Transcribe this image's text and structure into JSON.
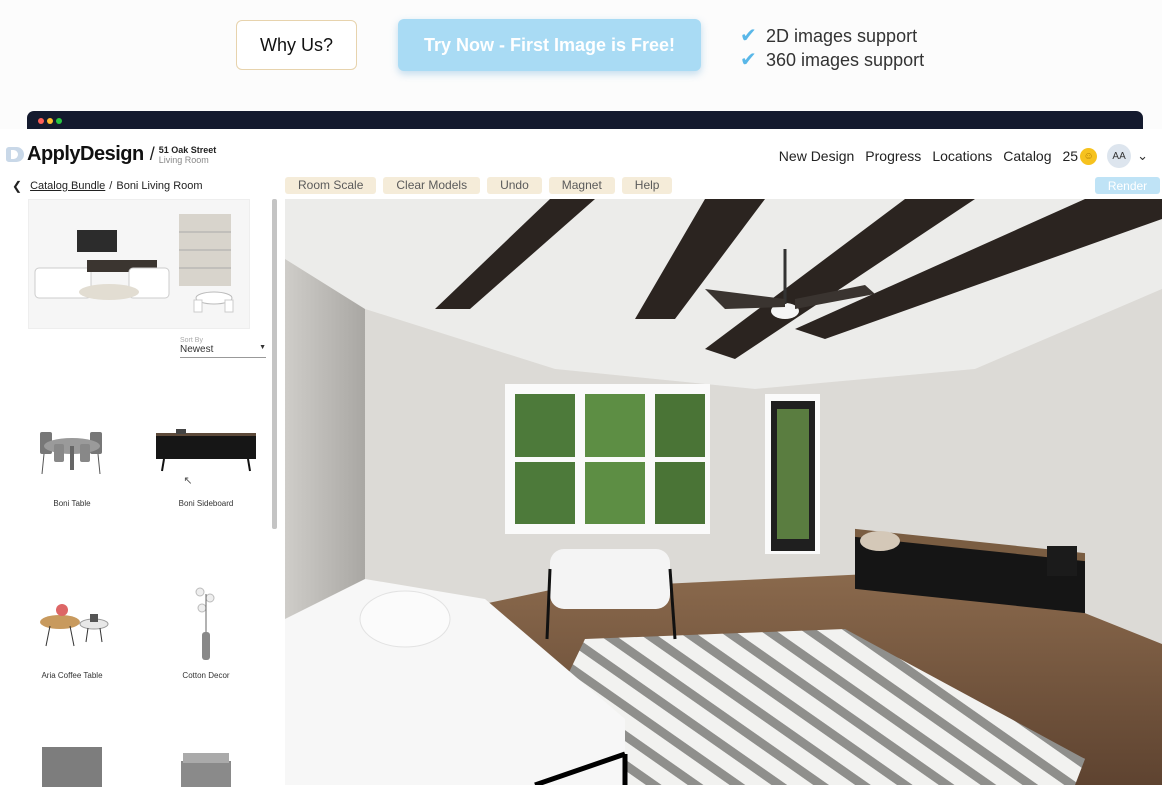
{
  "promo": {
    "why_label": "Why Us?",
    "try_label": "Try Now - First Image is Free!",
    "features": [
      "2D images support",
      "360 images support"
    ]
  },
  "header": {
    "logo": "ApplyDesign",
    "address_line": "51 Oak Street",
    "room_type": "Living Room",
    "nav": [
      "New Design",
      "Progress",
      "Locations",
      "Catalog"
    ],
    "credits": "25",
    "avatar": "AA"
  },
  "breadcrumb": {
    "parent": "Catalog Bundle",
    "current": "Boni Living Room"
  },
  "toolbar": {
    "buttons": [
      "Room Scale",
      "Clear Models",
      "Undo",
      "Magnet",
      "Help"
    ],
    "render_label": "Render"
  },
  "sidebar": {
    "sort_label": "Sort By",
    "sort_value": "Newest",
    "products": [
      "Boni Table",
      "Boni Sideboard",
      "Aria Coffee Table",
      "Cotton Decor"
    ]
  },
  "colors": {
    "accent": "#a9dbf4",
    "check": "#59b7e8",
    "tool_bg": "#f5ecd9",
    "window_bar": "#141a2e"
  }
}
